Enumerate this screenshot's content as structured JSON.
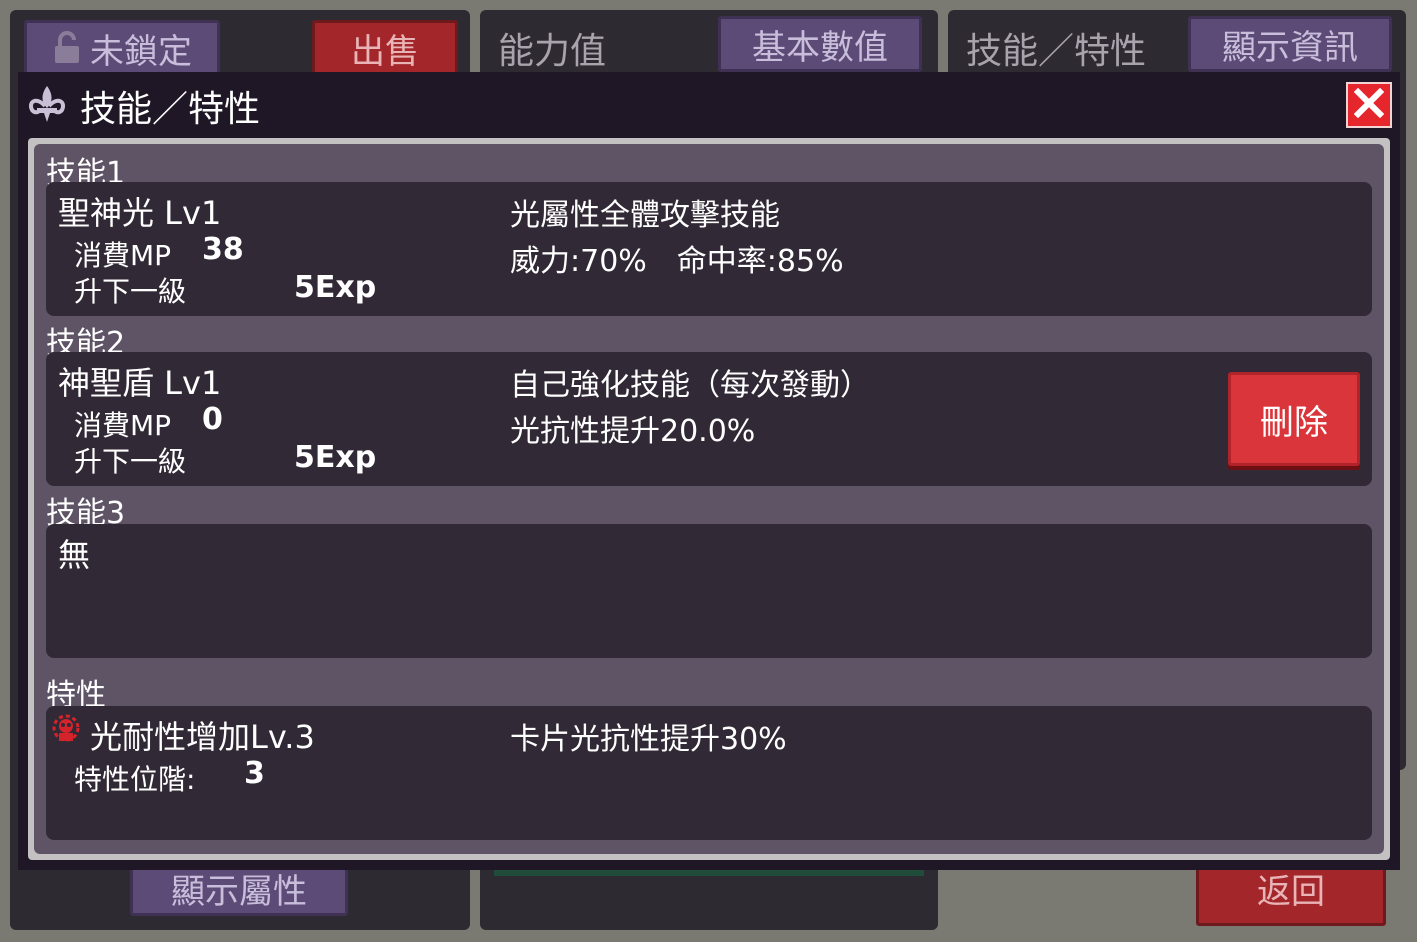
{
  "background": {
    "lock_button_label": "未鎖定",
    "sell_button_label": "出售",
    "stats_tab_label": "能力值",
    "basic_values_button_label": "基本數值",
    "skills_tab_label": "技能／特性",
    "show_info_button_label": "顯示資訊",
    "show_attributes_button_label": "顯示屬性",
    "back_button_label": "返回"
  },
  "modal": {
    "title": "技能／特性",
    "close_icon": "close-icon",
    "close_color": "#e5262d"
  },
  "skills": [
    {
      "section_title": "技能1",
      "name": "聖神光 Lv1",
      "mp_label": "消費MP",
      "mp_value": "38",
      "next_level_label": "升下一級",
      "next_level_value": "5Exp",
      "description": "光屬性全體攻擊技能",
      "detail": "威力:70%　命中率:85%"
    },
    {
      "section_title": "技能2",
      "name": "神聖盾 Lv1",
      "mp_label": "消費MP",
      "mp_value": "0",
      "next_level_label": "升下一級",
      "next_level_value": "5Exp",
      "description": "自己強化技能（每次發動）",
      "detail": "光抗性提升20.0%",
      "delete_label": "刪除"
    },
    {
      "section_title": "技能3",
      "name": "無"
    }
  ],
  "trait": {
    "section_title": "特性",
    "icon": "red-crest-icon",
    "name": "光耐性增加Lv.3",
    "rank_label": "特性位階:",
    "rank_value": "3",
    "description": "卡片光抗性提升30%"
  },
  "colors": {
    "panel_bg": "#312a36",
    "frame_bg": "#5e5466",
    "delete_button": "#d9353a",
    "accent_purple": "#5c4b76"
  }
}
